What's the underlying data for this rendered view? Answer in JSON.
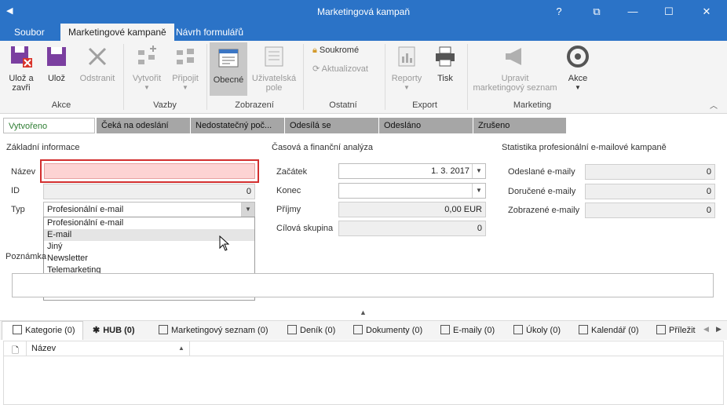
{
  "window": {
    "title": "Marketingová kampaň",
    "help": "?",
    "restore": "⧉",
    "minimize": "—",
    "maximize": "☐",
    "close": "✕"
  },
  "ribbon_tabs": [
    "Soubor",
    "Marketingové kampaně",
    "Návrh formulářů"
  ],
  "ribbon": {
    "save_close": "Ulož a\nzavři",
    "save": "Ulož",
    "delete": "Odstranit",
    "group_akce": "Akce",
    "create": "Vytvořit",
    "attach": "Připojit",
    "group_vazby": "Vazby",
    "general": "Obecné",
    "user_fields": "Uživatelská\npole",
    "group_zobrazeni": "Zobrazení",
    "private": "Soukromé",
    "refresh": "Aktualizovat",
    "group_ostatni": "Ostatní",
    "reports": "Reporty",
    "print": "Tisk",
    "group_export": "Export",
    "edit_list": "Upravit\nmarketingový seznam",
    "actions": "Akce",
    "group_marketing": "Marketing"
  },
  "status_steps": [
    "Vytvořeno",
    "Čeká na odeslání",
    "Nedostatečný poč...",
    "Odesílá se",
    "Odesláno",
    "Zrušeno"
  ],
  "basic": {
    "section": "Základní informace",
    "name_label": "Název",
    "name_value": "",
    "id_label": "ID",
    "id_value": "0",
    "type_label": "Typ",
    "type_value": "Profesionální e-mail",
    "note_label": "Poznámka",
    "type_options": [
      "Profesionální e-mail",
      "E-mail",
      "Jiný",
      "Newsletter",
      "Telemarketing"
    ]
  },
  "time": {
    "section": "Časová a finanční analýza",
    "start_label": "Začátek",
    "start_value": "1. 3. 2017",
    "end_label": "Konec",
    "end_value": "",
    "income_label": "Příjmy",
    "income_value": "0,00 EUR",
    "target_label": "Cílová skupina",
    "target_value": "0"
  },
  "stats": {
    "section": "Statistika profesionální e-mailové kampaně",
    "sent_label": "Odeslané e-maily",
    "sent_value": "0",
    "delivered_label": "Doručené e-maily",
    "delivered_value": "0",
    "shown_label": "Zobrazené e-maily",
    "shown_value": "0"
  },
  "bottom_tabs": [
    "Kategorie (0)",
    "HUB (0)",
    "Marketingový seznam (0)",
    "Deník (0)",
    "Dokumenty (0)",
    "E-maily (0)",
    "Úkoly (0)",
    "Kalendář (0)",
    "Příležit"
  ],
  "grid": {
    "col_name": "Název"
  },
  "colors": {
    "titlebar": "#2b73c7",
    "required_field": "#fdd3d3",
    "required_border": "#d32f2f"
  }
}
